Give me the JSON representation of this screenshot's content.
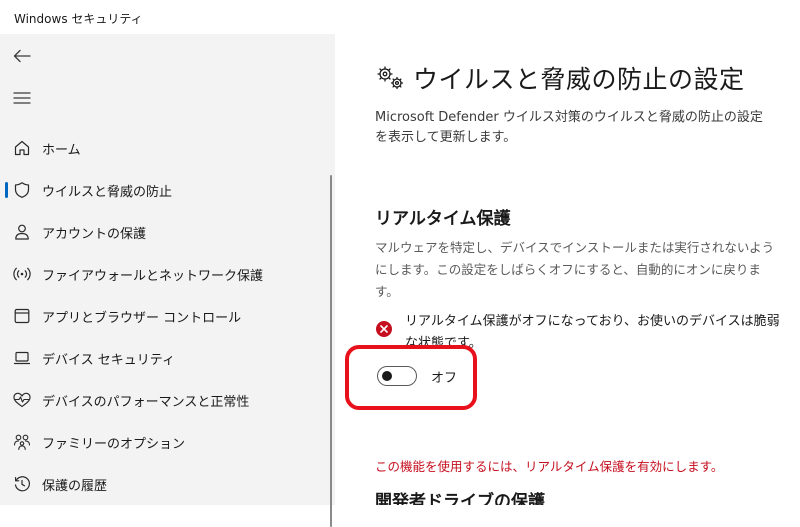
{
  "window": {
    "title": "Windows セキュリティ"
  },
  "sidebar": {
    "back_icon": "back-arrow-icon",
    "menu_icon": "hamburger-menu-icon",
    "items": [
      {
        "label": "ホーム",
        "icon": "home-icon",
        "selected": false
      },
      {
        "label": "ウイルスと脅威の防止",
        "icon": "shield-icon",
        "selected": true
      },
      {
        "label": "アカウントの保護",
        "icon": "person-icon",
        "selected": false
      },
      {
        "label": "ファイアウォールとネットワーク保護",
        "icon": "wifi-signal-icon",
        "selected": false
      },
      {
        "label": "アプリとブラウザー コントロール",
        "icon": "app-window-icon",
        "selected": false
      },
      {
        "label": "デバイス セキュリティ",
        "icon": "laptop-icon",
        "selected": false
      },
      {
        "label": "デバイスのパフォーマンスと正常性",
        "icon": "heart-pulse-icon",
        "selected": false
      },
      {
        "label": "ファミリーのオプション",
        "icon": "family-icon",
        "selected": false
      },
      {
        "label": "保護の履歴",
        "icon": "history-icon",
        "selected": false
      }
    ]
  },
  "main": {
    "page_title": "ウイルスと脅威の防止の設定",
    "page_icon": "gears-icon",
    "description": "Microsoft Defender ウイルス対策のウイルスと脅威の防止の設定を表示して更新します。",
    "realtime": {
      "title": "リアルタイム保護",
      "description": "マルウェアを特定し、デバイスでインストールまたは実行されないようにします。この設定をしばらくオフにすると、自動的にオンに戻ります。",
      "warning_text": "リアルタイム保護がオフになっており、お使いのデバイスは脆弱な状態です。",
      "warning_icon": "error-circle-icon",
      "toggle_label": "オフ",
      "toggle_on": false
    },
    "requirement_text": "この機能を使用するには、リアルタイム保護を有効にします。",
    "dev_drive_title": "開発者ドライブの保護"
  },
  "colors": {
    "accent": "#0067c0",
    "highlight_box": "#e8101a",
    "error": "#c50f1f",
    "sidebar_bg": "#f3f3f3"
  }
}
